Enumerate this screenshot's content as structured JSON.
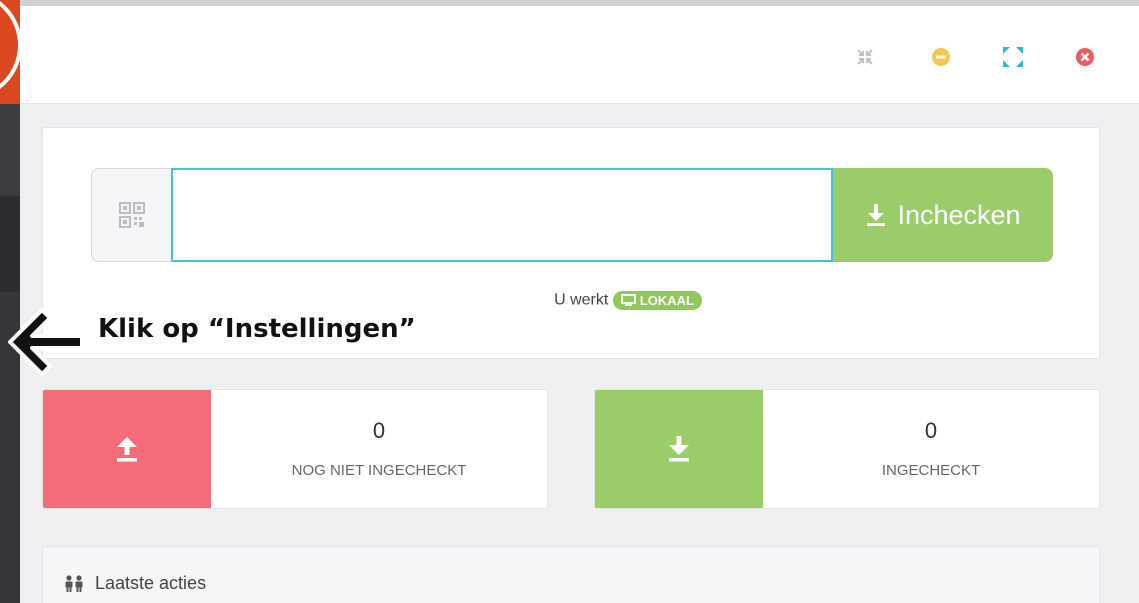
{
  "checkin": {
    "input_value": "",
    "button_label": "Inchecken",
    "mode_prefix": "U werkt",
    "mode_badge": "LOKAAL"
  },
  "stats": {
    "not_checked_in": {
      "count": "0",
      "label": "NOG NIET INGECHECKT",
      "color": "#f46c78"
    },
    "checked_in": {
      "count": "0",
      "label": "INGECHECKT",
      "color": "#9acd6a"
    }
  },
  "recent": {
    "title": "Laatste acties"
  },
  "annotation": {
    "text": "Klik op “Instellingen”"
  },
  "colors": {
    "accent_green": "#9acd6a",
    "accent_red": "#f46c78",
    "input_focus": "#3fc4d6",
    "brand_orange": "#d9481f"
  },
  "icons": {
    "compress": "compress-icon",
    "minimize": "minimize-icon",
    "fullscreen": "fullscreen-icon",
    "close": "close-icon",
    "qr": "qr-code-icon",
    "download": "download-icon",
    "upload": "upload-icon",
    "users": "users-icon",
    "monitor": "monitor-icon",
    "arrow": "arrow-left-icon"
  }
}
